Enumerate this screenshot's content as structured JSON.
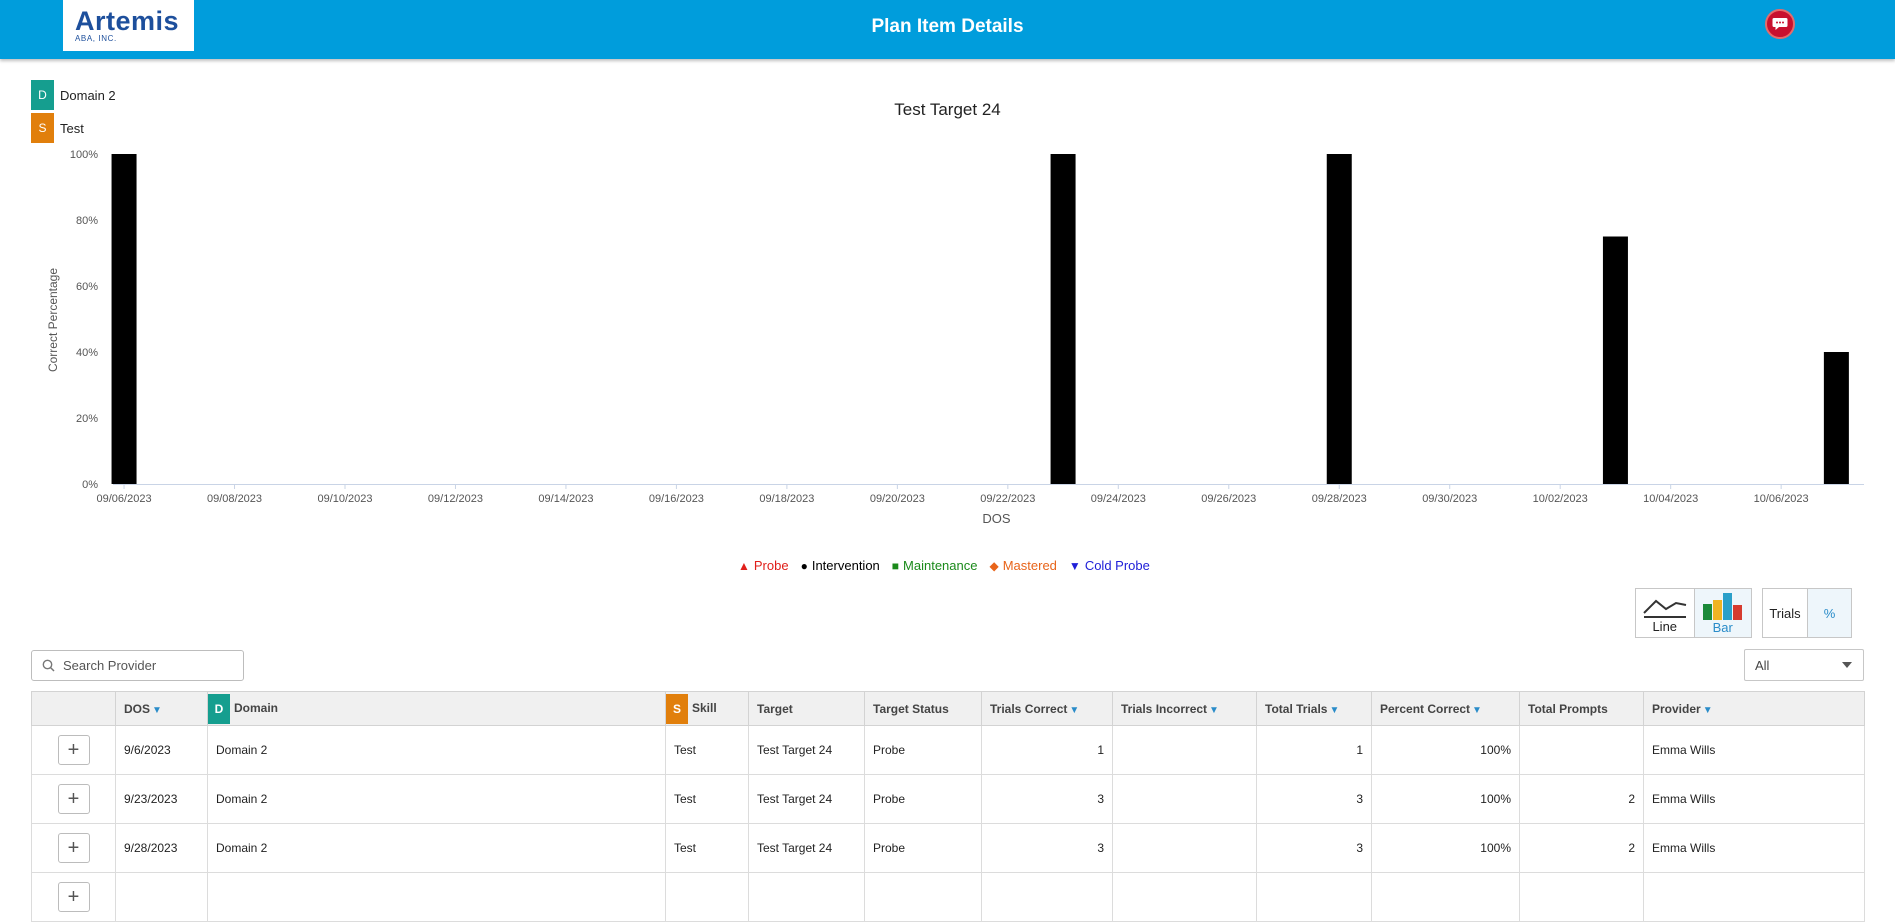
{
  "header": {
    "logo_main": "Artemis",
    "logo_sub": "ABA, INC.",
    "title": "Plan Item Details",
    "chat_icon": "chat-bubble-icon"
  },
  "tags": [
    {
      "letter": "D",
      "label": "Domain 2",
      "color": "#159e8f"
    },
    {
      "letter": "S",
      "label": "Test",
      "color": "#e17f0c"
    }
  ],
  "chart_data": {
    "type": "bar",
    "title": "Test Target 24",
    "xlabel": "DOS",
    "ylabel": "Correct Percentage",
    "ylim": [
      0,
      100
    ],
    "yticks": [
      "0%",
      "20%",
      "40%",
      "60%",
      "80%",
      "100%"
    ],
    "xticks": [
      "09/06/2023",
      "09/08/2023",
      "09/10/2023",
      "09/12/2023",
      "09/14/2023",
      "09/16/2023",
      "09/18/2023",
      "09/20/2023",
      "09/22/2023",
      "09/24/2023",
      "09/26/2023",
      "09/28/2023",
      "09/30/2023",
      "10/02/2023",
      "10/04/2023",
      "10/06/2023"
    ],
    "x_range": [
      "2023-09-05.8",
      "2023-10-07.5"
    ],
    "bars": [
      {
        "date": "2023-09-06",
        "value": 100
      },
      {
        "date": "2023-09-23",
        "value": 100
      },
      {
        "date": "2023-09-28",
        "value": 100
      },
      {
        "date": "2023-10-03",
        "value": 75
      },
      {
        "date": "2023-10-07",
        "value": 40
      }
    ],
    "bar_color": "#000000",
    "grid": false
  },
  "legend": [
    {
      "symbol": "▲",
      "label": "Probe",
      "color": "#e0201b"
    },
    {
      "symbol": "●",
      "label": "Intervention",
      "color": "#000000"
    },
    {
      "symbol": "■",
      "label": "Maintenance",
      "color": "#1b8a1b"
    },
    {
      "symbol": "◆",
      "label": "Mastered",
      "color": "#e8641a"
    },
    {
      "symbol": "▼",
      "label": "Cold Probe",
      "color": "#2020d8"
    }
  ],
  "chart_toggle": {
    "line": "Line",
    "bar": "Bar",
    "active": "Bar"
  },
  "metric_toggle": {
    "trials": "Trials",
    "percent": "%",
    "active": "%"
  },
  "search": {
    "placeholder": "Search Provider"
  },
  "filter": {
    "value": "All"
  },
  "table": {
    "headers": {
      "dos": "DOS",
      "domain_tag": "D",
      "domain": "Domain",
      "skill_tag": "S",
      "skill": "Skill",
      "target": "Target",
      "target_status": "Target Status",
      "trials_correct": "Trials Correct",
      "trials_incorrect": "Trials Incorrect",
      "total_trials": "Total Trials",
      "percent_correct": "Percent Correct",
      "total_prompts": "Total Prompts",
      "provider": "Provider"
    },
    "rows": [
      {
        "dos": "9/6/2023",
        "domain": "Domain 2",
        "skill": "Test",
        "target": "Test Target 24",
        "status": "Probe",
        "trials_correct": "1",
        "trials_incorrect": "",
        "total_trials": "1",
        "percent": "100%",
        "prompts": "",
        "provider": "Emma Wills"
      },
      {
        "dos": "9/23/2023",
        "domain": "Domain 2",
        "skill": "Test",
        "target": "Test Target 24",
        "status": "Probe",
        "trials_correct": "3",
        "trials_incorrect": "",
        "total_trials": "3",
        "percent": "100%",
        "prompts": "2",
        "provider": "Emma Wills"
      },
      {
        "dos": "9/28/2023",
        "domain": "Domain 2",
        "skill": "Test",
        "target": "Test Target 24",
        "status": "Probe",
        "trials_correct": "3",
        "trials_incorrect": "",
        "total_trials": "3",
        "percent": "100%",
        "prompts": "2",
        "provider": "Emma Wills"
      },
      {
        "dos": "",
        "domain": "",
        "skill": "",
        "target": "",
        "status": "",
        "trials_correct": "",
        "trials_incorrect": "",
        "total_trials": "",
        "percent": "",
        "prompts": "",
        "provider": ""
      }
    ]
  }
}
